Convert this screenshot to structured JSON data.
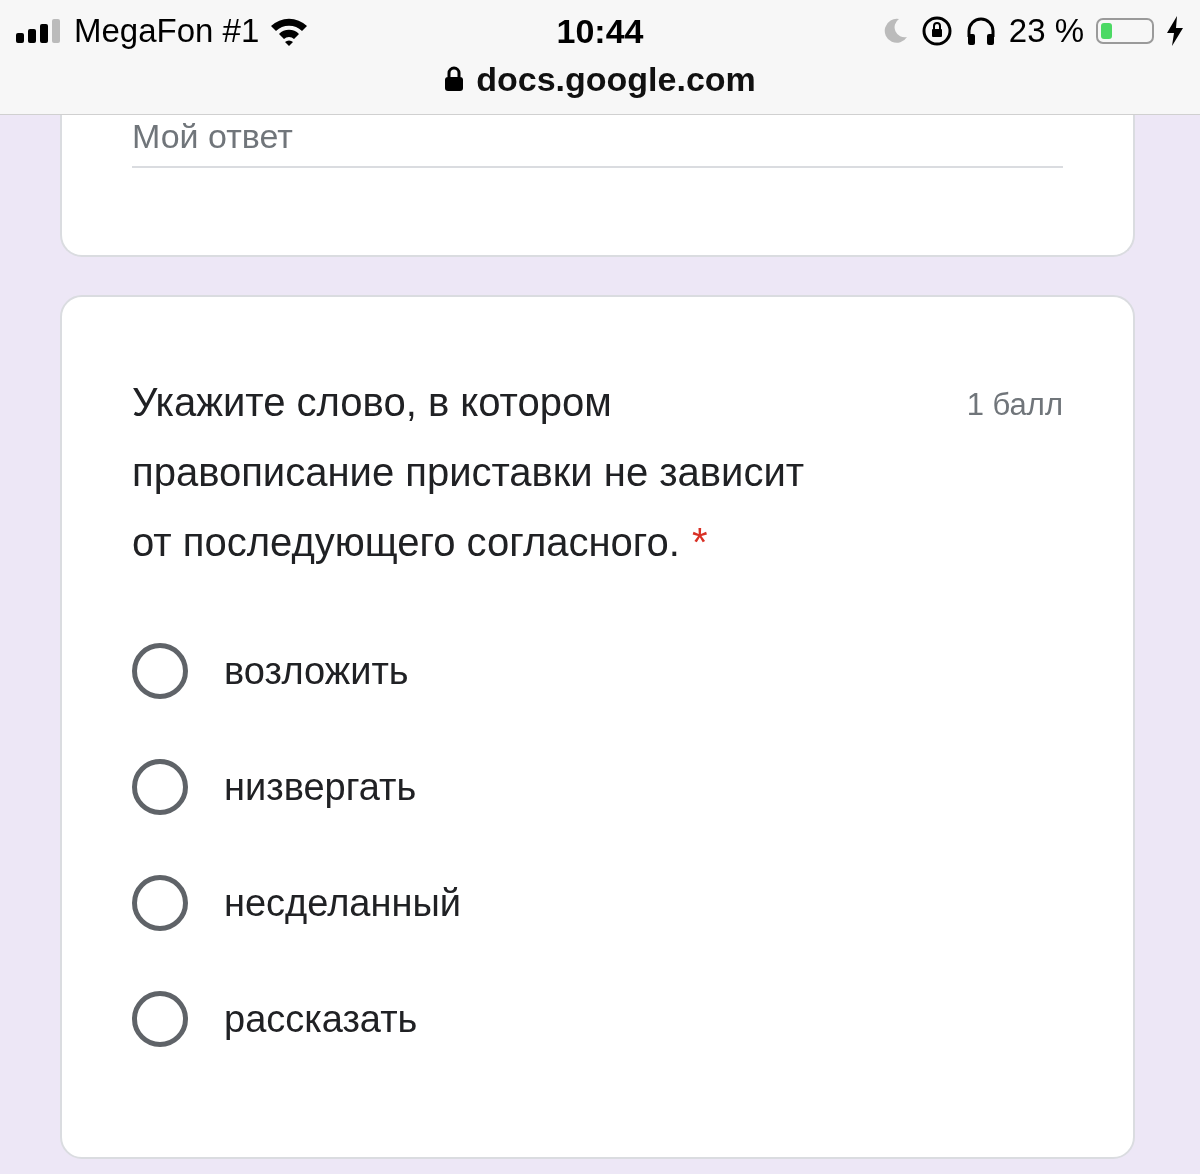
{
  "status_bar": {
    "carrier": "MegaFon #1",
    "time": "10:44",
    "battery_text": "23 %",
    "battery": {
      "level": 0.23,
      "charging": true
    }
  },
  "address_bar": {
    "url": "docs.google.com"
  },
  "previous_question": {
    "answer": {
      "placeholder": "Мой ответ"
    }
  },
  "question": {
    "title": "Укажите слово, в котором правописание приставки не зависит от последующего согласного.",
    "required": true,
    "required_mark": "*",
    "points": "1 балл",
    "options": [
      {
        "label": "возложить",
        "selected": false
      },
      {
        "label": "низвергать",
        "selected": false
      },
      {
        "label": "несделанный",
        "selected": false
      },
      {
        "label": "рассказать",
        "selected": false
      }
    ]
  }
}
